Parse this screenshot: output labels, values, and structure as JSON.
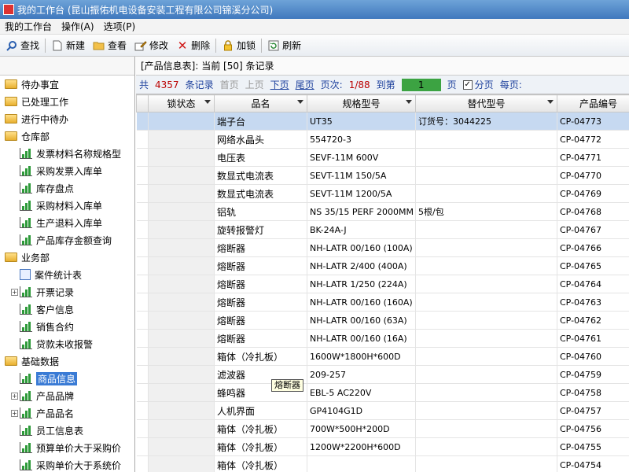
{
  "window": {
    "title": "我的工作台 (昆山振佑机电设备安装工程有限公司锦溪分公司)"
  },
  "menu": [
    "我的工作台",
    "操作(A)",
    "选项(P)"
  ],
  "toolbar": {
    "search": "查找",
    "new": "新建",
    "view": "查看",
    "edit": "修改",
    "delete": "删除",
    "lock": "加锁",
    "refresh": "刷新"
  },
  "sidebar": {
    "nodes": [
      {
        "label": "待办事宜",
        "icon": "folder-icon",
        "level": 0
      },
      {
        "label": "已处理工作",
        "icon": "folder-icon",
        "level": 0
      },
      {
        "label": "进行中待办",
        "icon": "folder-icon",
        "level": 0
      },
      {
        "label": "仓库部",
        "icon": "folder-icon",
        "level": 0
      },
      {
        "label": "发票材料名称规格型",
        "icon": "report-icon",
        "level": 1
      },
      {
        "label": "采购发票入库单",
        "icon": "report-icon",
        "level": 1
      },
      {
        "label": "库存盘点",
        "icon": "report-icon",
        "level": 1
      },
      {
        "label": "采购材料入库单",
        "icon": "report-icon",
        "level": 1
      },
      {
        "label": "生产退料入库单",
        "icon": "report-icon",
        "level": 1
      },
      {
        "label": "产品库存金额查询",
        "icon": "report-icon",
        "level": 1
      },
      {
        "label": "业务部",
        "icon": "folder-icon",
        "level": 0
      },
      {
        "label": "案件统计表",
        "icon": "form-icon",
        "level": 1
      },
      {
        "label": "开票记录",
        "icon": "report-icon",
        "level": 1,
        "expand": "+"
      },
      {
        "label": "客户信息",
        "icon": "report-icon",
        "level": 1
      },
      {
        "label": "销售合约",
        "icon": "report-icon",
        "level": 1
      },
      {
        "label": "贷款未收报警",
        "icon": "report-icon",
        "level": 1
      },
      {
        "label": "基础数据",
        "icon": "folder-icon",
        "level": 0
      },
      {
        "label": "商品信息",
        "icon": "report-icon",
        "level": 1,
        "selected": true
      },
      {
        "label": "产品品牌",
        "icon": "report-icon",
        "level": 1,
        "expand": "+"
      },
      {
        "label": "产品品名",
        "icon": "report-icon",
        "level": 1,
        "expand": "+"
      },
      {
        "label": "员工信息表",
        "icon": "report-icon",
        "level": 1
      },
      {
        "label": "预算单价大于采购价",
        "icon": "report-icon",
        "level": 1
      },
      {
        "label": "采购单价大于系统价",
        "icon": "report-icon",
        "level": 1
      }
    ]
  },
  "info": {
    "text": "[产品信息表]: 当前 [50] 条记录"
  },
  "pager": {
    "total_prefix": "共",
    "total": "4357",
    "total_suffix": "条记录",
    "first": "首页",
    "prev": "上页",
    "next": "下页",
    "last": "尾页",
    "page_label": "页次:",
    "page": "1/88",
    "goto": "到第",
    "goto_value": "1",
    "goto_suffix": "页",
    "paging_label": "分页",
    "per_page_label": "每页:"
  },
  "table": {
    "columns": [
      "锁状态",
      "品名",
      "规格型号",
      "替代型号",
      "产品编号"
    ],
    "rows": [
      {
        "name": "端子台",
        "spec": "UT35",
        "alt": "订货号：3044225",
        "code": "CP-04773"
      },
      {
        "name": "网络水晶头",
        "spec": "554720-3",
        "alt": "",
        "code": "CP-04772"
      },
      {
        "name": "电压表",
        "spec": "SEVF-11M 600V",
        "alt": "",
        "code": "CP-04771"
      },
      {
        "name": "数显式电流表",
        "spec": "SEVT-11M 150/5A",
        "alt": "",
        "code": "CP-04770"
      },
      {
        "name": "数显式电流表",
        "spec": "SEVT-11M 1200/5A",
        "alt": "",
        "code": "CP-04769"
      },
      {
        "name": "铝轨",
        "spec": "NS 35/15 PERF 2000MM",
        "alt": "5根/包",
        "code": "CP-04768"
      },
      {
        "name": "旋转报警灯",
        "spec": "BK-24A-J",
        "alt": "",
        "code": "CP-04767"
      },
      {
        "name": "熔断器",
        "spec": "NH-LATR 00/160 (100A)",
        "alt": "",
        "code": "CP-04766"
      },
      {
        "name": "熔断器",
        "spec": "NH-LATR 2/400 (400A)",
        "alt": "",
        "code": "CP-04765"
      },
      {
        "name": "熔断器",
        "spec": "NH-LATR 1/250 (224A)",
        "alt": "",
        "code": "CP-04764"
      },
      {
        "name": "熔断器",
        "spec": "NH-LATR 00/160 (160A)",
        "alt": "",
        "code": "CP-04763"
      },
      {
        "name": "熔断器",
        "spec": "NH-LATR 00/160 (63A)",
        "alt": "",
        "code": "CP-04762"
      },
      {
        "name": "熔断器",
        "spec": "NH-LATR 00/160 (16A)",
        "alt": "",
        "code": "CP-04761"
      },
      {
        "name": "箱体（冷扎板）",
        "spec": "1600W*1800H*600D",
        "alt": "",
        "code": "CP-04760"
      },
      {
        "name": "滤波器",
        "spec": "209-257",
        "alt": "",
        "code": "CP-04759"
      },
      {
        "name": "蜂鸣器",
        "spec": "EBL-5 AC220V",
        "alt": "",
        "code": "CP-04758"
      },
      {
        "name": "人机界面",
        "spec": "GP4104G1D",
        "alt": "",
        "code": "CP-04757"
      },
      {
        "name": "箱体（冷扎板）",
        "spec": "700W*500H*200D",
        "alt": "",
        "code": "CP-04756"
      },
      {
        "name": "箱体（冷扎板）",
        "spec": "1200W*2200H*600D",
        "alt": "",
        "code": "CP-04755"
      },
      {
        "name": "箱体（冷扎板）",
        "spec": "",
        "alt": "",
        "code": "CP-04754"
      }
    ]
  },
  "tooltip": {
    "text": "熔断器"
  }
}
